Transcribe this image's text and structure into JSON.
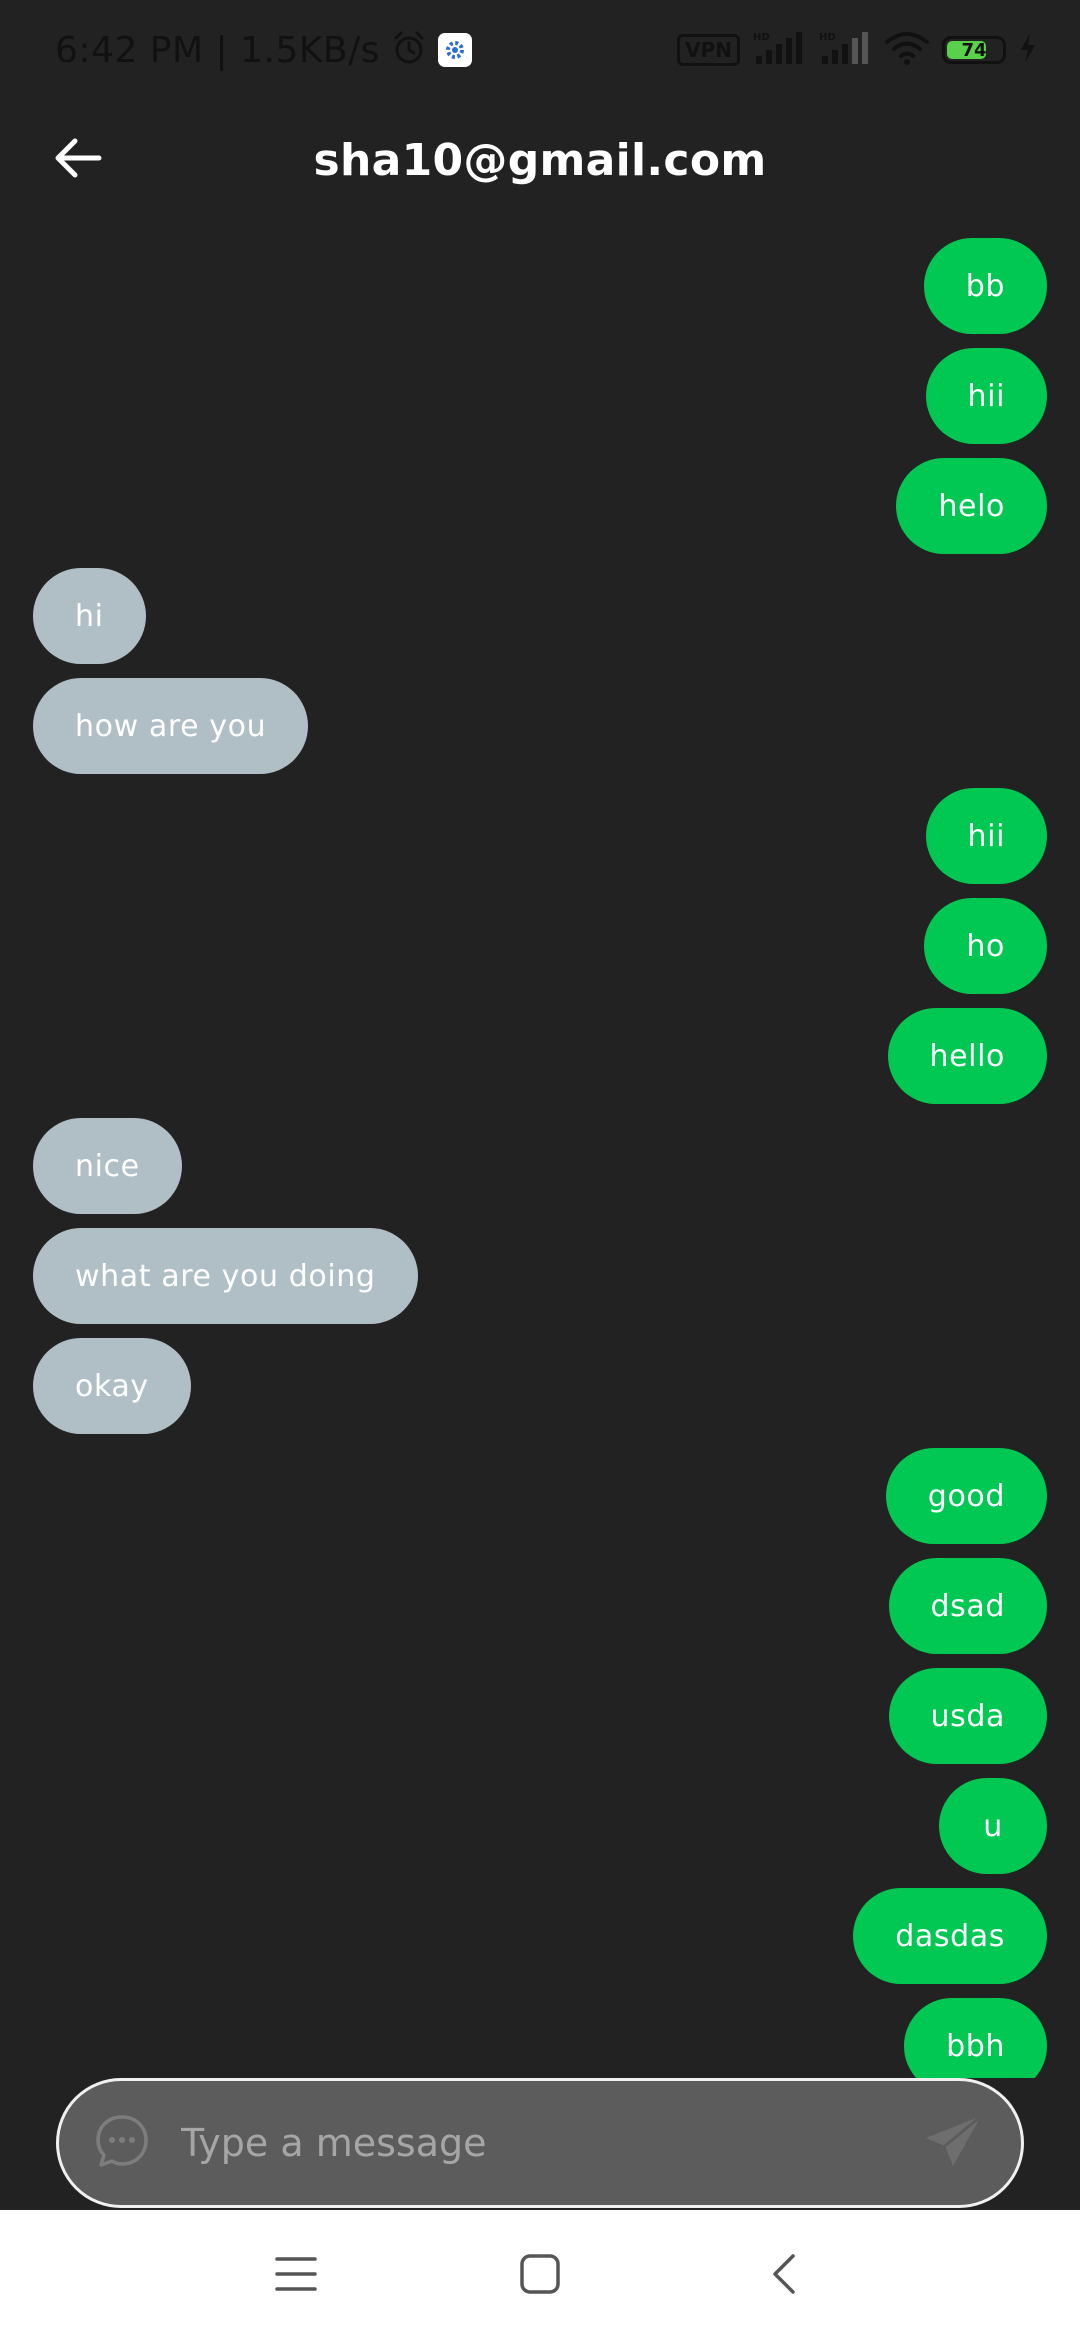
{
  "status_bar": {
    "time_speed": "6:42 PM | 1.5KB/s",
    "vpn_label": "VPN",
    "hd_label": "HD",
    "battery_level": "74",
    "battery_fraction": 0.74,
    "icons": [
      "alarm-icon",
      "settings-app-icon",
      "vpn-icon",
      "signal-hd-icon",
      "signal-hd-icon",
      "wifi-icon",
      "battery-icon",
      "charging-icon"
    ]
  },
  "header": {
    "title": "sha10@gmail.com",
    "back_icon": "arrow-left-icon"
  },
  "messages": [
    {
      "side": "sent",
      "text": "bb"
    },
    {
      "side": "sent",
      "text": "hii"
    },
    {
      "side": "sent",
      "text": "helo"
    },
    {
      "side": "received",
      "text": "hi"
    },
    {
      "side": "received",
      "text": "how are you"
    },
    {
      "side": "sent",
      "text": "hii"
    },
    {
      "side": "sent",
      "text": "ho"
    },
    {
      "side": "sent",
      "text": "hello"
    },
    {
      "side": "received",
      "text": "nice"
    },
    {
      "side": "received",
      "text": "what are you doing"
    },
    {
      "side": "received",
      "text": "okay"
    },
    {
      "side": "sent",
      "text": "good"
    },
    {
      "side": "sent",
      "text": "dsad"
    },
    {
      "side": "sent",
      "text": "usda"
    },
    {
      "side": "sent",
      "text": "u"
    },
    {
      "side": "sent",
      "text": "dasdas"
    },
    {
      "side": "sent",
      "text": "bbh"
    }
  ],
  "input": {
    "placeholder": "Type a message",
    "value": "",
    "chat_icon": "chat-bubble-icon",
    "send_icon": "send-icon"
  },
  "nav": {
    "icons": [
      "menu-icon",
      "home-icon",
      "back-icon"
    ]
  },
  "colors": {
    "background": "#222222",
    "sent_bubble": "#00c853",
    "received_bubble": "#b0bec5",
    "input_bg": "#5c5c5c",
    "battery_fill": "#5ad14a"
  }
}
